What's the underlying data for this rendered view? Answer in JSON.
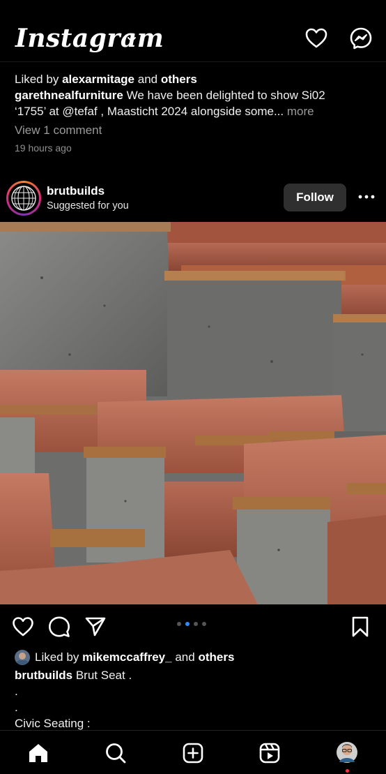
{
  "header": {
    "logo": "Instagram"
  },
  "previous_post": {
    "liked_by_prefix": "Liked by",
    "liked_by_user": "alexarmitage",
    "liked_by_and": "and",
    "liked_by_others": "others",
    "caption_user": "garethnealfurniture",
    "caption_line1": "We have been delighted to show Si02",
    "caption_line2": "‘1755’ at @tefaf , Maasticht 2024 alongside some...",
    "more_label": "more",
    "view_comments": "View 1 comment",
    "timestamp": "19 hours ago"
  },
  "post": {
    "username": "brutbuilds",
    "subtitle": "Suggested for you",
    "follow_label": "Follow",
    "carousel_total": 4,
    "carousel_active": 2,
    "liked_by_prefix": "Liked by",
    "liked_by_user": "mikemccaffrey_",
    "liked_by_and": "and",
    "liked_by_others": "others",
    "caption_user": "brutbuilds",
    "caption_text": "Brut Seat .",
    "caption_extra": [
      ".",
      ".",
      "Civic Seating :"
    ]
  },
  "colors": {
    "background": "#000000",
    "follow_bg": "#2f2f2f",
    "carousel_active": "#2f8cff",
    "notification_dot": "#ff3040"
  }
}
